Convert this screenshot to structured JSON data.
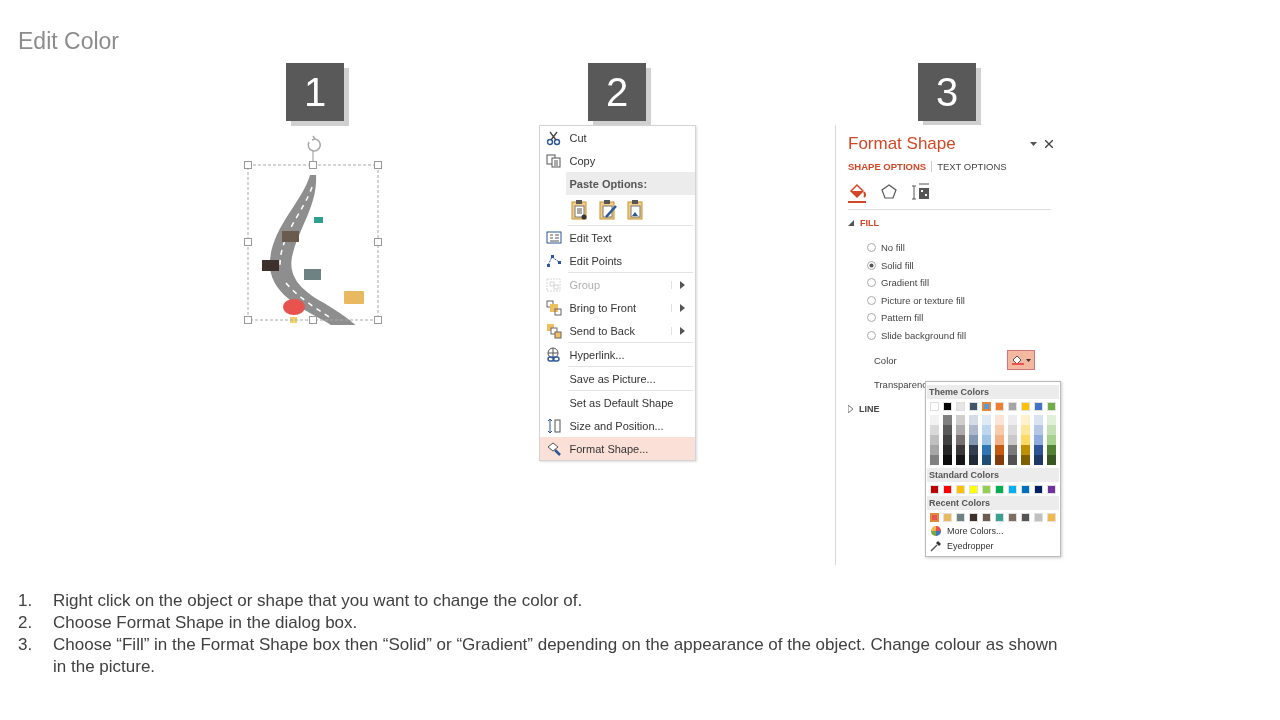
{
  "title": "Edit Color",
  "steps": [
    {
      "number": "1"
    },
    {
      "number": "2"
    },
    {
      "number": "3"
    }
  ],
  "context_menu": {
    "items": [
      {
        "kind": "item",
        "label": "Cut",
        "disabled": false,
        "submenu": false,
        "selected": false,
        "divider": false
      },
      {
        "kind": "item",
        "label": "Copy",
        "disabled": false,
        "submenu": false,
        "selected": false,
        "divider": false
      },
      {
        "kind": "header",
        "label": "Paste Options:",
        "disabled": false,
        "submenu": false,
        "selected": false,
        "divider": false
      },
      {
        "kind": "paste-icons"
      },
      {
        "kind": "item",
        "label": "Edit Text",
        "disabled": false,
        "submenu": false,
        "selected": false,
        "divider": true
      },
      {
        "kind": "item",
        "label": "Edit Points",
        "disabled": false,
        "submenu": false,
        "selected": false,
        "divider": false
      },
      {
        "kind": "item",
        "label": "Group",
        "disabled": true,
        "submenu": true,
        "selected": false,
        "divider": true
      },
      {
        "kind": "item",
        "label": "Bring to Front",
        "disabled": false,
        "submenu": true,
        "selected": false,
        "divider": false
      },
      {
        "kind": "item",
        "label": "Send to Back",
        "disabled": false,
        "submenu": true,
        "selected": false,
        "divider": false
      },
      {
        "kind": "item",
        "label": "Hyperlink...",
        "disabled": false,
        "submenu": false,
        "selected": false,
        "divider": true
      },
      {
        "kind": "item",
        "label": "Save as Picture...",
        "disabled": false,
        "submenu": false,
        "selected": false,
        "divider": true
      },
      {
        "kind": "item",
        "label": "Set as Default Shape",
        "disabled": false,
        "submenu": false,
        "selected": false,
        "divider": true
      },
      {
        "kind": "item",
        "label": "Size and Position...",
        "disabled": false,
        "submenu": false,
        "selected": false,
        "divider": false
      },
      {
        "kind": "item",
        "label": "Format Shape...",
        "disabled": false,
        "submenu": false,
        "selected": true,
        "divider": false
      }
    ]
  },
  "format_pane": {
    "title": "Format Shape",
    "tabs": [
      {
        "label": "SHAPE OPTIONS",
        "selected": true
      },
      {
        "label": "TEXT OPTIONS",
        "selected": false
      }
    ],
    "icon_tabs": [
      {
        "selected": true
      },
      {
        "selected": false
      },
      {
        "selected": false
      }
    ],
    "fill": {
      "label": "FILL",
      "expanded": true,
      "options": [
        {
          "label": "No fill",
          "selected": false
        },
        {
          "label": "Solid fill",
          "selected": true
        },
        {
          "label": "Gradient fill",
          "selected": false
        },
        {
          "label": "Picture or texture fill",
          "selected": false
        },
        {
          "label": "Pattern fill",
          "selected": false
        },
        {
          "label": "Slide background fill",
          "selected": false
        }
      ],
      "color_label": "Color",
      "color_button_pressed": true,
      "transparency_label": "Transparenc"
    },
    "line": {
      "label": "LINE",
      "expanded": false
    },
    "color_picker": {
      "theme_heading": "Theme Colors",
      "theme": [
        {
          "color": "#ffffff",
          "selected": false,
          "shades": [
            {
              "color": "#f2f2f2"
            },
            {
              "color": "#d9d9d9"
            },
            {
              "color": "#bfbfbf"
            },
            {
              "color": "#a6a6a6"
            },
            {
              "color": "#808080"
            }
          ]
        },
        {
          "color": "#000000",
          "selected": false,
          "shades": [
            {
              "color": "#7f7f7f"
            },
            {
              "color": "#595959"
            },
            {
              "color": "#404040"
            },
            {
              "color": "#262626"
            },
            {
              "color": "#0d0d0d"
            }
          ]
        },
        {
          "color": "#e7e6e6",
          "selected": false,
          "shades": [
            {
              "color": "#d0cece"
            },
            {
              "color": "#aeabab"
            },
            {
              "color": "#757171"
            },
            {
              "color": "#3a3838"
            },
            {
              "color": "#171616"
            }
          ]
        },
        {
          "color": "#44546a",
          "selected": false,
          "shades": [
            {
              "color": "#d6dce5"
            },
            {
              "color": "#adb9ca"
            },
            {
              "color": "#8497b0"
            },
            {
              "color": "#333f50"
            },
            {
              "color": "#222a35"
            }
          ]
        },
        {
          "color": "#5b9bd5",
          "selected": true,
          "shades": [
            {
              "color": "#deebf7"
            },
            {
              "color": "#bdd7ee"
            },
            {
              "color": "#9dc3e6"
            },
            {
              "color": "#2e75b6"
            },
            {
              "color": "#1f4e79"
            }
          ]
        },
        {
          "color": "#ed7d31",
          "selected": false,
          "shades": [
            {
              "color": "#fbe5d6"
            },
            {
              "color": "#f8cbad"
            },
            {
              "color": "#f4b183"
            },
            {
              "color": "#c55a11"
            },
            {
              "color": "#843c0c"
            }
          ]
        },
        {
          "color": "#a5a5a5",
          "selected": false,
          "shades": [
            {
              "color": "#ededed"
            },
            {
              "color": "#dbdbdb"
            },
            {
              "color": "#c9c9c9"
            },
            {
              "color": "#7b7b7b"
            },
            {
              "color": "#525252"
            }
          ]
        },
        {
          "color": "#ffc000",
          "selected": false,
          "shades": [
            {
              "color": "#fff2cc"
            },
            {
              "color": "#ffe699"
            },
            {
              "color": "#ffd966"
            },
            {
              "color": "#bf9000"
            },
            {
              "color": "#7f6000"
            }
          ]
        },
        {
          "color": "#4472c4",
          "selected": false,
          "shades": [
            {
              "color": "#dae3f3"
            },
            {
              "color": "#b4c7e7"
            },
            {
              "color": "#8faadc"
            },
            {
              "color": "#2f5597"
            },
            {
              "color": "#203864"
            }
          ]
        },
        {
          "color": "#70ad47",
          "selected": false,
          "shades": [
            {
              "color": "#e2f0d9"
            },
            {
              "color": "#c5e0b4"
            },
            {
              "color": "#a9d18e"
            },
            {
              "color": "#548235"
            },
            {
              "color": "#385723"
            }
          ]
        }
      ],
      "standard_heading": "Standard Colors",
      "standard": [
        {
          "color": "#c00000"
        },
        {
          "color": "#ff0000"
        },
        {
          "color": "#ffc000"
        },
        {
          "color": "#ffff00"
        },
        {
          "color": "#92d050"
        },
        {
          "color": "#00b050"
        },
        {
          "color": "#00b0f0"
        },
        {
          "color": "#0070c0"
        },
        {
          "color": "#002060"
        },
        {
          "color": "#7030a0"
        }
      ],
      "recent_heading": "Recent Colors",
      "recent": [
        {
          "color": "#e8524f",
          "selected": true
        },
        {
          "color": "#e8b960",
          "selected": false
        },
        {
          "color": "#6f8283",
          "selected": false
        },
        {
          "color": "#3e302b",
          "selected": false
        },
        {
          "color": "#6e5b50",
          "selected": false
        },
        {
          "color": "#3aa092",
          "selected": false
        },
        {
          "color": "#7d6e63",
          "selected": false
        },
        {
          "color": "#555555",
          "selected": false
        },
        {
          "color": "#c0c0c0",
          "selected": false
        },
        {
          "color": "#f2b94f",
          "selected": false
        }
      ],
      "actions": [
        {
          "label": "More Colors..."
        },
        {
          "label": "Eyedropper"
        }
      ]
    }
  },
  "instructions": [
    {
      "number": "1.",
      "text": "Right click on the object or shape that you want to change the color of."
    },
    {
      "number": "2.",
      "text": "Choose Format Shape in the dialog box."
    },
    {
      "number": "3.",
      "text": "Choose “Fill” in the Format Shape box then “Solid” or “Gradient” depending on the appearance of the object. Change colour as shown in the picture."
    }
  ]
}
